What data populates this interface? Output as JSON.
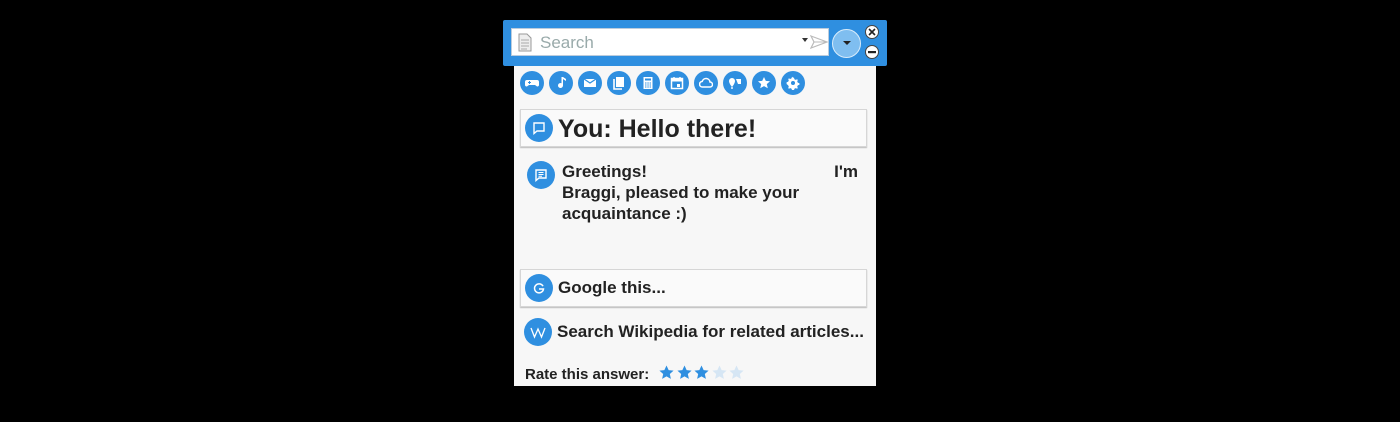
{
  "search": {
    "placeholder": "Search",
    "value": ""
  },
  "toolbar": {
    "icons": [
      "gamepad-icon",
      "music-icon",
      "mail-icon",
      "library-icon",
      "calculator-icon",
      "calendar-icon",
      "cloud-icon",
      "maps-icon",
      "star-icon",
      "gear-icon"
    ]
  },
  "chat": {
    "you_message": "You: Hello there!",
    "reply_line1_left": "Greetings!",
    "reply_line1_right": "I'm",
    "reply_line2": "Braggi, pleased to make your",
    "reply_line3": "acquaintance :)"
  },
  "actions": {
    "google_label": "Google this...",
    "wikipedia_label": "Search Wikipedia for related articles..."
  },
  "rating": {
    "label": "Rate this answer:",
    "value": 3,
    "max": 5
  },
  "colors": {
    "accent": "#2f8fe0",
    "star_on": "#2f8fe0",
    "star_off": "#d6e6f4"
  }
}
